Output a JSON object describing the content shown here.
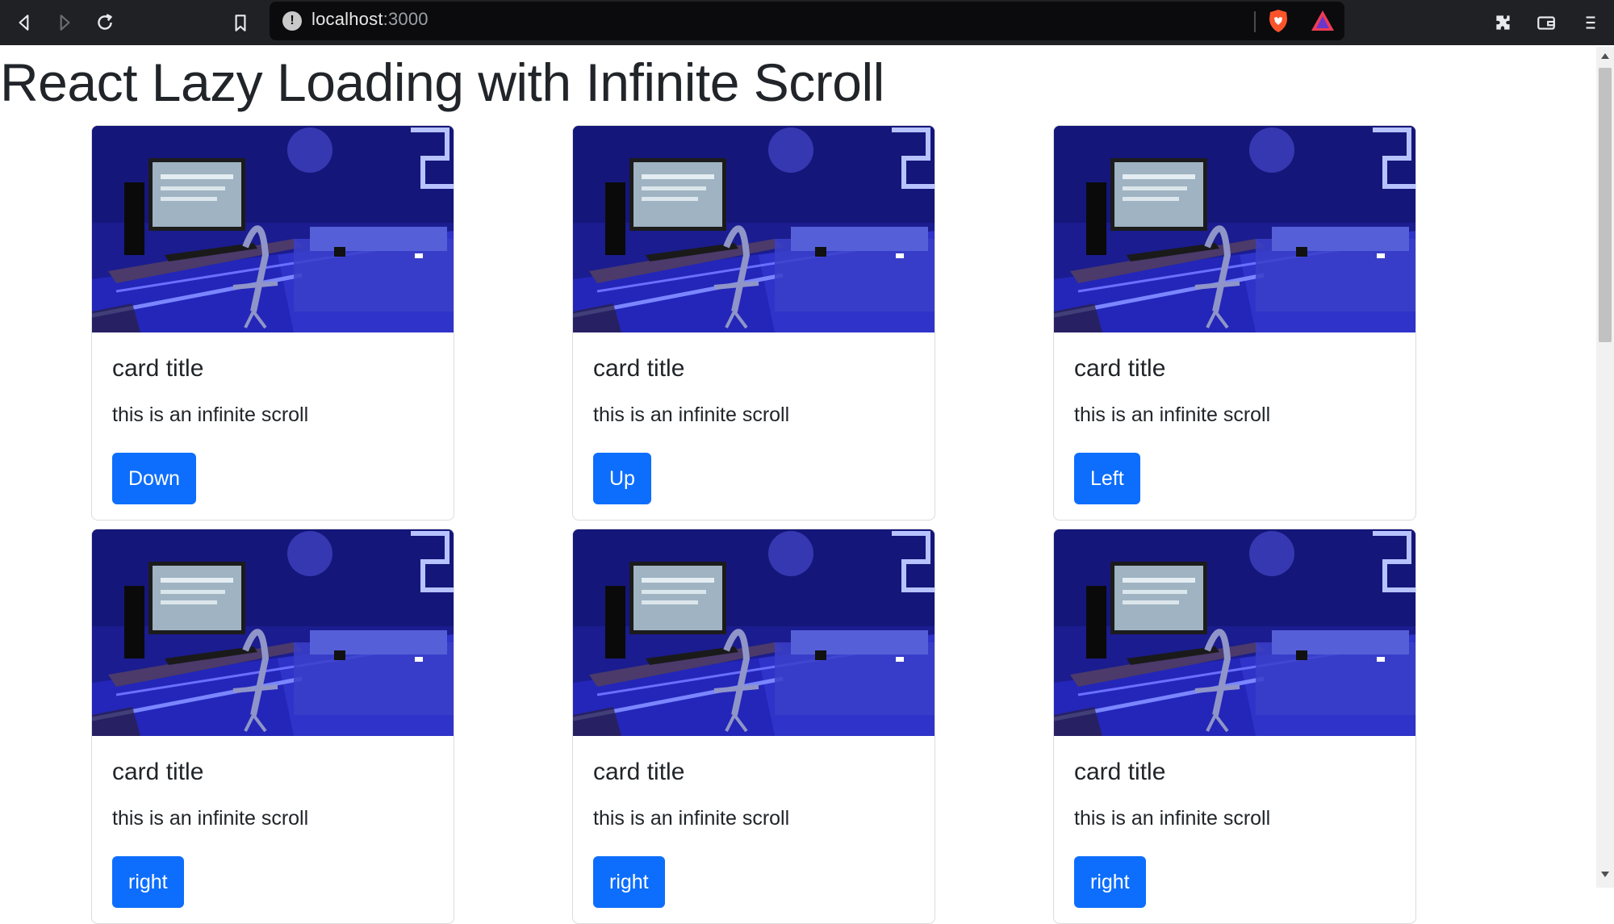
{
  "browser": {
    "url_host": "localhost",
    "url_port": ":3000",
    "icons": [
      "back-icon",
      "forward-icon",
      "reload-icon",
      "bookmark-icon",
      "info-icon",
      "brave-shield-icon",
      "brave-rewards-icon",
      "extensions-icon",
      "wallet-icon",
      "menu-icon"
    ]
  },
  "page": {
    "title": "React Lazy Loading with Infinite Scroll"
  },
  "cards": [
    {
      "title": "card title",
      "text": "this is an infinite scroll",
      "button": "Down"
    },
    {
      "title": "card title",
      "text": "this is an infinite scroll",
      "button": "Up"
    },
    {
      "title": "card title",
      "text": "this is an infinite scroll",
      "button": "Left"
    },
    {
      "title": "card title",
      "text": "this is an infinite scroll",
      "button": "right"
    },
    {
      "title": "card title",
      "text": "this is an infinite scroll",
      "button": "right"
    },
    {
      "title": "card title",
      "text": "this is an infinite scroll",
      "button": "right"
    }
  ],
  "colors": {
    "button": "#0d6efd",
    "image_base": "#1a1a9e",
    "toolbar": "#202124"
  }
}
